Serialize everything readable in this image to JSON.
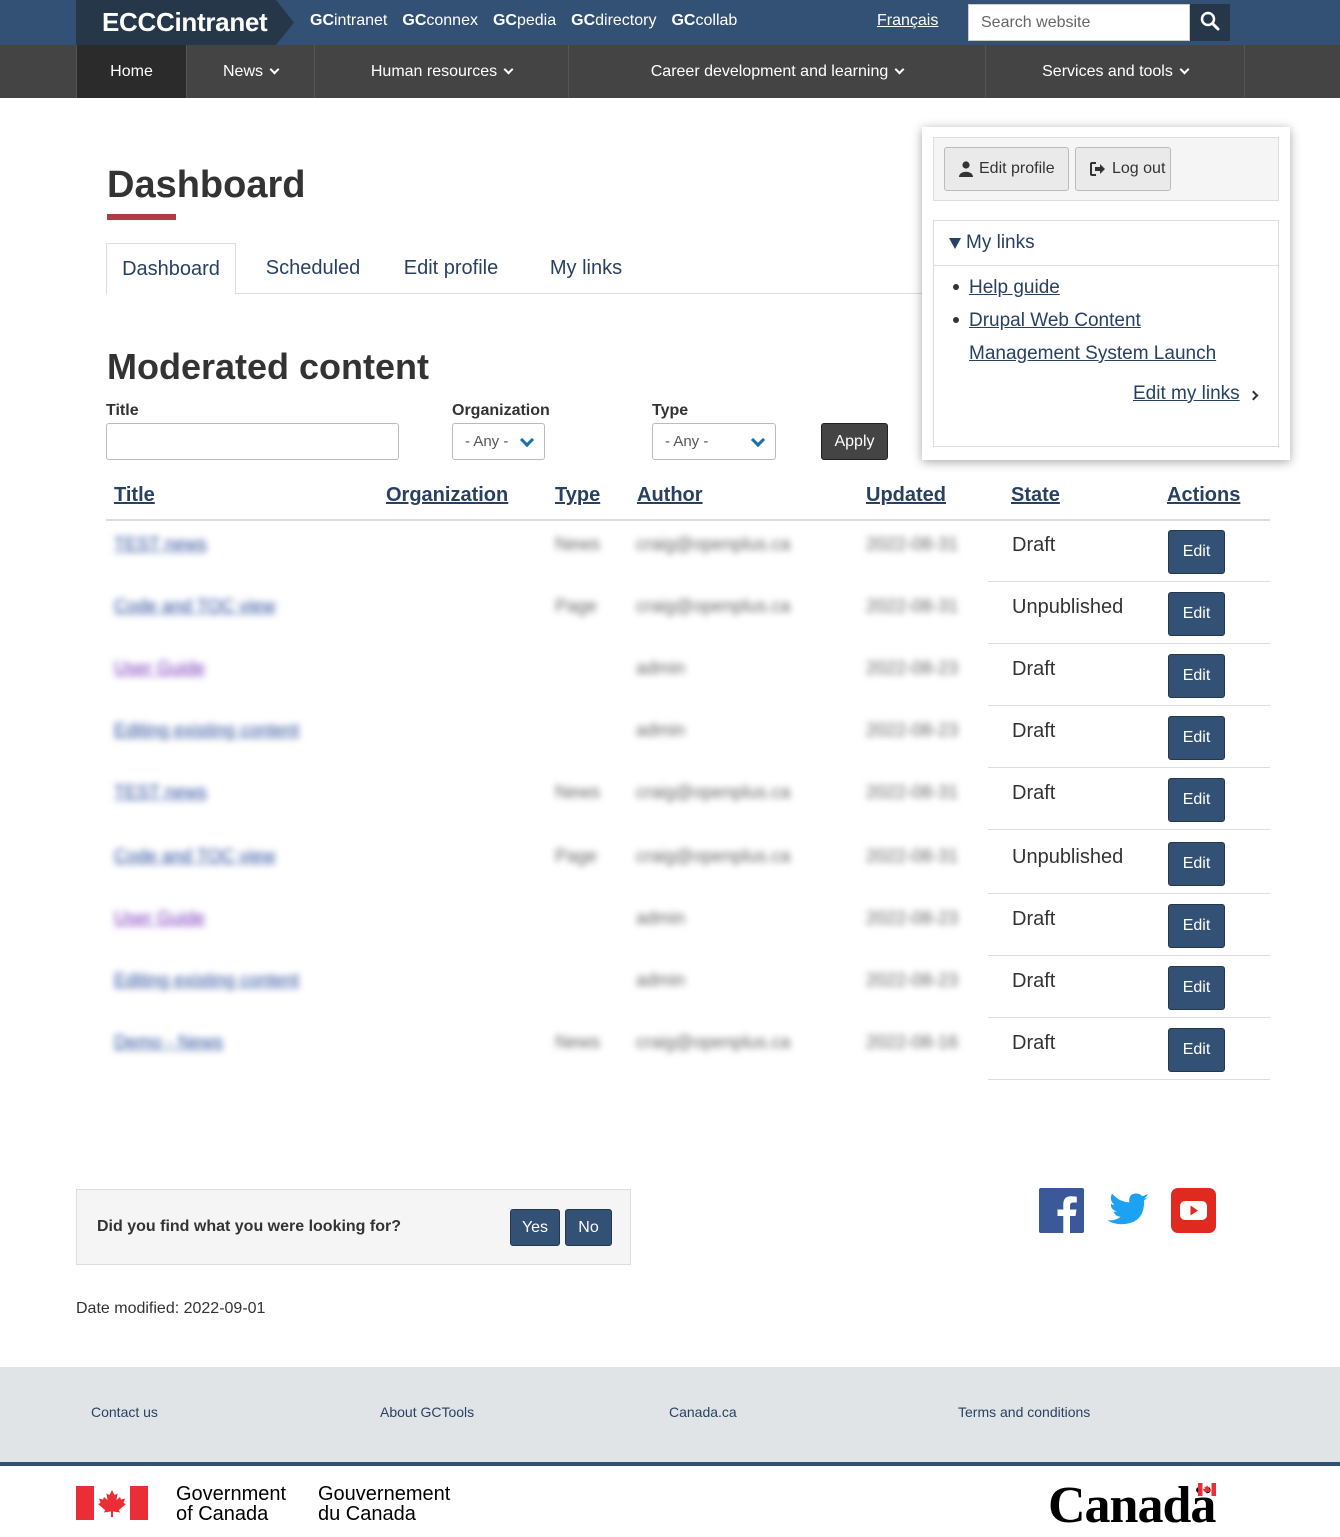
{
  "topbar": {
    "brand": "ECCCintranet",
    "gc_links": [
      {
        "prefix": "GC",
        "rest": "intranet"
      },
      {
        "prefix": "GC",
        "rest": "connex"
      },
      {
        "prefix": "GC",
        "rest": "pedia"
      },
      {
        "prefix": "GC",
        "rest": "directory"
      },
      {
        "prefix": "GC",
        "rest": "collab"
      }
    ],
    "language": "Français",
    "search_placeholder": "Search website",
    "search_icon": "search-icon"
  },
  "nav": {
    "items": [
      "Home",
      "News",
      "Human resources",
      "Career development and learning",
      "Services and tools"
    ]
  },
  "page": {
    "title": "Dashboard",
    "tabs": [
      "Dashboard",
      "Scheduled",
      "Edit profile",
      "My links"
    ],
    "section_title": "Moderated content"
  },
  "filters": {
    "title_label": "Title",
    "organization_label": "Organization",
    "organization_value": "- Any -",
    "type_label": "Type",
    "type_value": "- Any -",
    "apply": "Apply"
  },
  "table": {
    "headers": [
      "Title",
      "Organization",
      "Type",
      "Author",
      "Updated",
      "State",
      "Actions"
    ],
    "rows": [
      {
        "title": "TEST news",
        "type": "News",
        "author": "craig@openplus.ca",
        "updated": "2022-08-31",
        "state": "Draft",
        "action": "Edit",
        "visited": false
      },
      {
        "title": "Code and TOC view",
        "type": "Page",
        "author": "craig@openplus.ca",
        "updated": "2022-08-31",
        "state": "Unpublished",
        "action": "Edit",
        "visited": false
      },
      {
        "title": "User Guide",
        "type": "",
        "author": "admin",
        "updated": "2022-08-23",
        "state": "Draft",
        "action": "Edit",
        "visited": true
      },
      {
        "title": "Editing existing content",
        "type": "",
        "author": "admin",
        "updated": "2022-08-23",
        "state": "Draft",
        "action": "Edit",
        "visited": false
      },
      {
        "title": "TEST news",
        "type": "News",
        "author": "craig@openplus.ca",
        "updated": "2022-08-31",
        "state": "Draft",
        "action": "Edit",
        "visited": false
      },
      {
        "title": "Code and TOC view",
        "type": "Page",
        "author": "craig@openplus.ca",
        "updated": "2022-08-31",
        "state": "Unpublished",
        "action": "Edit",
        "visited": false
      },
      {
        "title": "User Guide",
        "type": "",
        "author": "admin",
        "updated": "2022-08-23",
        "state": "Draft",
        "action": "Edit",
        "visited": true
      },
      {
        "title": "Editing existing content",
        "type": "",
        "author": "admin",
        "updated": "2022-08-23",
        "state": "Draft",
        "action": "Edit",
        "visited": false
      },
      {
        "title": "Demo - News",
        "type": "News",
        "author": "craig@openplus.ca",
        "updated": "2022-08-16",
        "state": "Draft",
        "action": "Edit",
        "visited": false
      }
    ]
  },
  "user_panel": {
    "edit_profile": "Edit profile",
    "log_out": "Log out",
    "my_links_heading": "My links",
    "links": [
      "Help guide",
      "Drupal Web Content Management System Launch"
    ],
    "edit_my_links": "Edit my links"
  },
  "feedback": {
    "question": "Did you find what you were looking for?",
    "yes": "Yes",
    "no": "No"
  },
  "social": [
    "facebook-icon",
    "twitter-icon",
    "youtube-icon"
  ],
  "date_modified": "Date modified: 2022-09-01",
  "footer": {
    "links": [
      "Contact us",
      "About GCTools",
      "Canada.ca",
      "Terms and conditions"
    ],
    "gov_en": [
      "Government",
      "of Canada"
    ],
    "gov_fr": [
      "Gouvernement",
      "du Canada"
    ],
    "wordmark": "Canadä"
  },
  "colors": {
    "topbar": "#335075",
    "brand": "#26374a",
    "nav": "#444444",
    "accent_red": "#af3c43",
    "link": "#284162",
    "button": "#335075"
  }
}
